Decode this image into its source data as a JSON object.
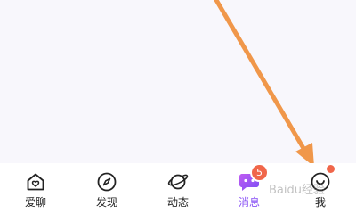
{
  "tabbar": {
    "items": [
      {
        "label": "爱聊",
        "icon": "home-heart-icon",
        "active": false
      },
      {
        "label": "发现",
        "icon": "compass-icon",
        "active": false
      },
      {
        "label": "动态",
        "icon": "planet-icon",
        "active": false
      },
      {
        "label": "消息",
        "icon": "message-bubble-icon",
        "active": true,
        "badge": "5"
      },
      {
        "label": "我",
        "icon": "smiley-face-icon",
        "active": false,
        "dot": true
      }
    ]
  },
  "watermark": "Baidu经验",
  "colors": {
    "active": "#8a53f5",
    "badge": "#f0664a",
    "arrow": "#f0974a",
    "background": "#f8f7fc"
  }
}
